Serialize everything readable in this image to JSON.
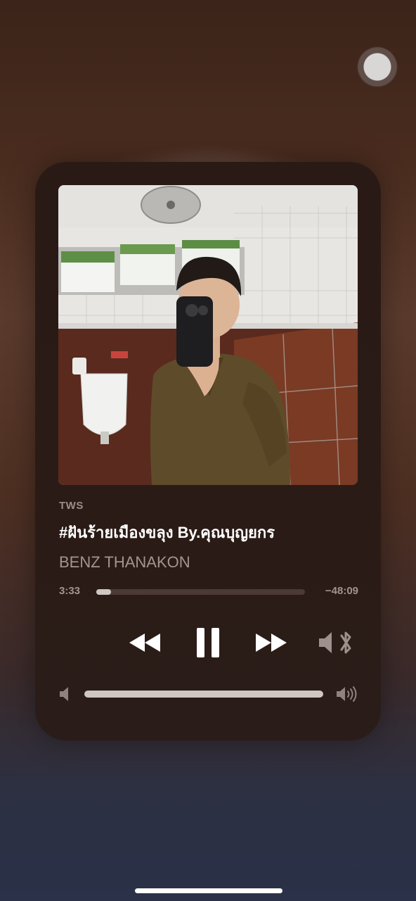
{
  "now_playing": {
    "source": "TWS",
    "title": "#ฝันร้ายเมืองขลุง By.คุณบุญยกร",
    "artist": "BENZ THANAKON",
    "elapsed": "3:33",
    "remaining": "−48:09",
    "progress_fraction": 0.07,
    "volume_fraction": 1.0
  },
  "icons": {
    "rewind": "rewind-icon",
    "pause": "pause-icon",
    "forward": "fast-forward-icon",
    "output": "speaker-bluetooth-icon",
    "volume_low": "volume-low-icon",
    "volume_high": "volume-high-icon"
  },
  "colors": {
    "card_bg": "#2a1a15",
    "text_primary": "#ffffff",
    "text_secondary": "#a29591"
  }
}
